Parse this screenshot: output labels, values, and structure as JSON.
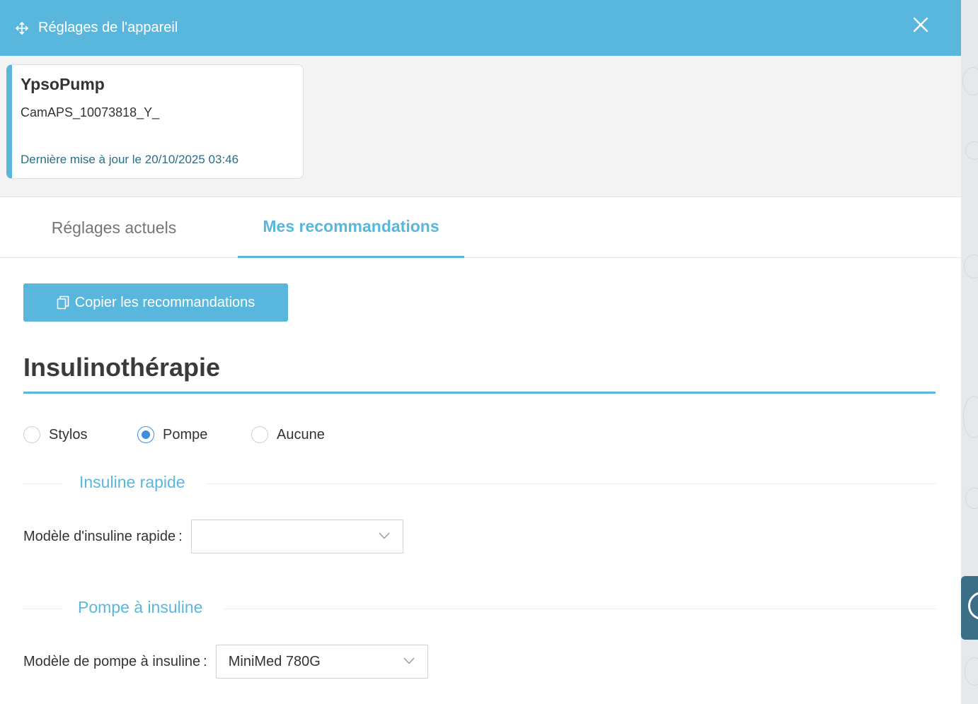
{
  "header": {
    "title": "Réglages de l'appareil",
    "move_icon": "move-icon",
    "close_icon": "close-icon"
  },
  "device": {
    "name": "YpsoPump",
    "serial": "CamAPS_10073818_Y_",
    "last_update": "Dernière mise à jour le 20/10/2025 03:46"
  },
  "tabs": [
    {
      "label": "Réglages actuels",
      "active": false
    },
    {
      "label": "Mes recommandations",
      "active": true
    }
  ],
  "copy_button": {
    "label": "Copier les recommandations",
    "icon": "copy-icon"
  },
  "section": {
    "title": "Insulinothérapie"
  },
  "therapy_options": [
    {
      "label": "Stylos",
      "checked": false
    },
    {
      "label": "Pompe",
      "checked": true
    },
    {
      "label": "Aucune",
      "checked": false
    }
  ],
  "rapid_insulin": {
    "heading": "Insuline rapide",
    "field_label": "Modèle d'insuline rapide",
    "colon": ":",
    "value": ""
  },
  "pump": {
    "heading": "Pompe à insuline",
    "field_label": "Modèle de pompe à insuline",
    "colon": ":",
    "value": "MiniMed 780G"
  },
  "colors": {
    "accent": "#59b7dd",
    "radio_checked": "#3d8fe0",
    "link_text": "#2b6c86",
    "side_tab": "#3a6f87"
  }
}
